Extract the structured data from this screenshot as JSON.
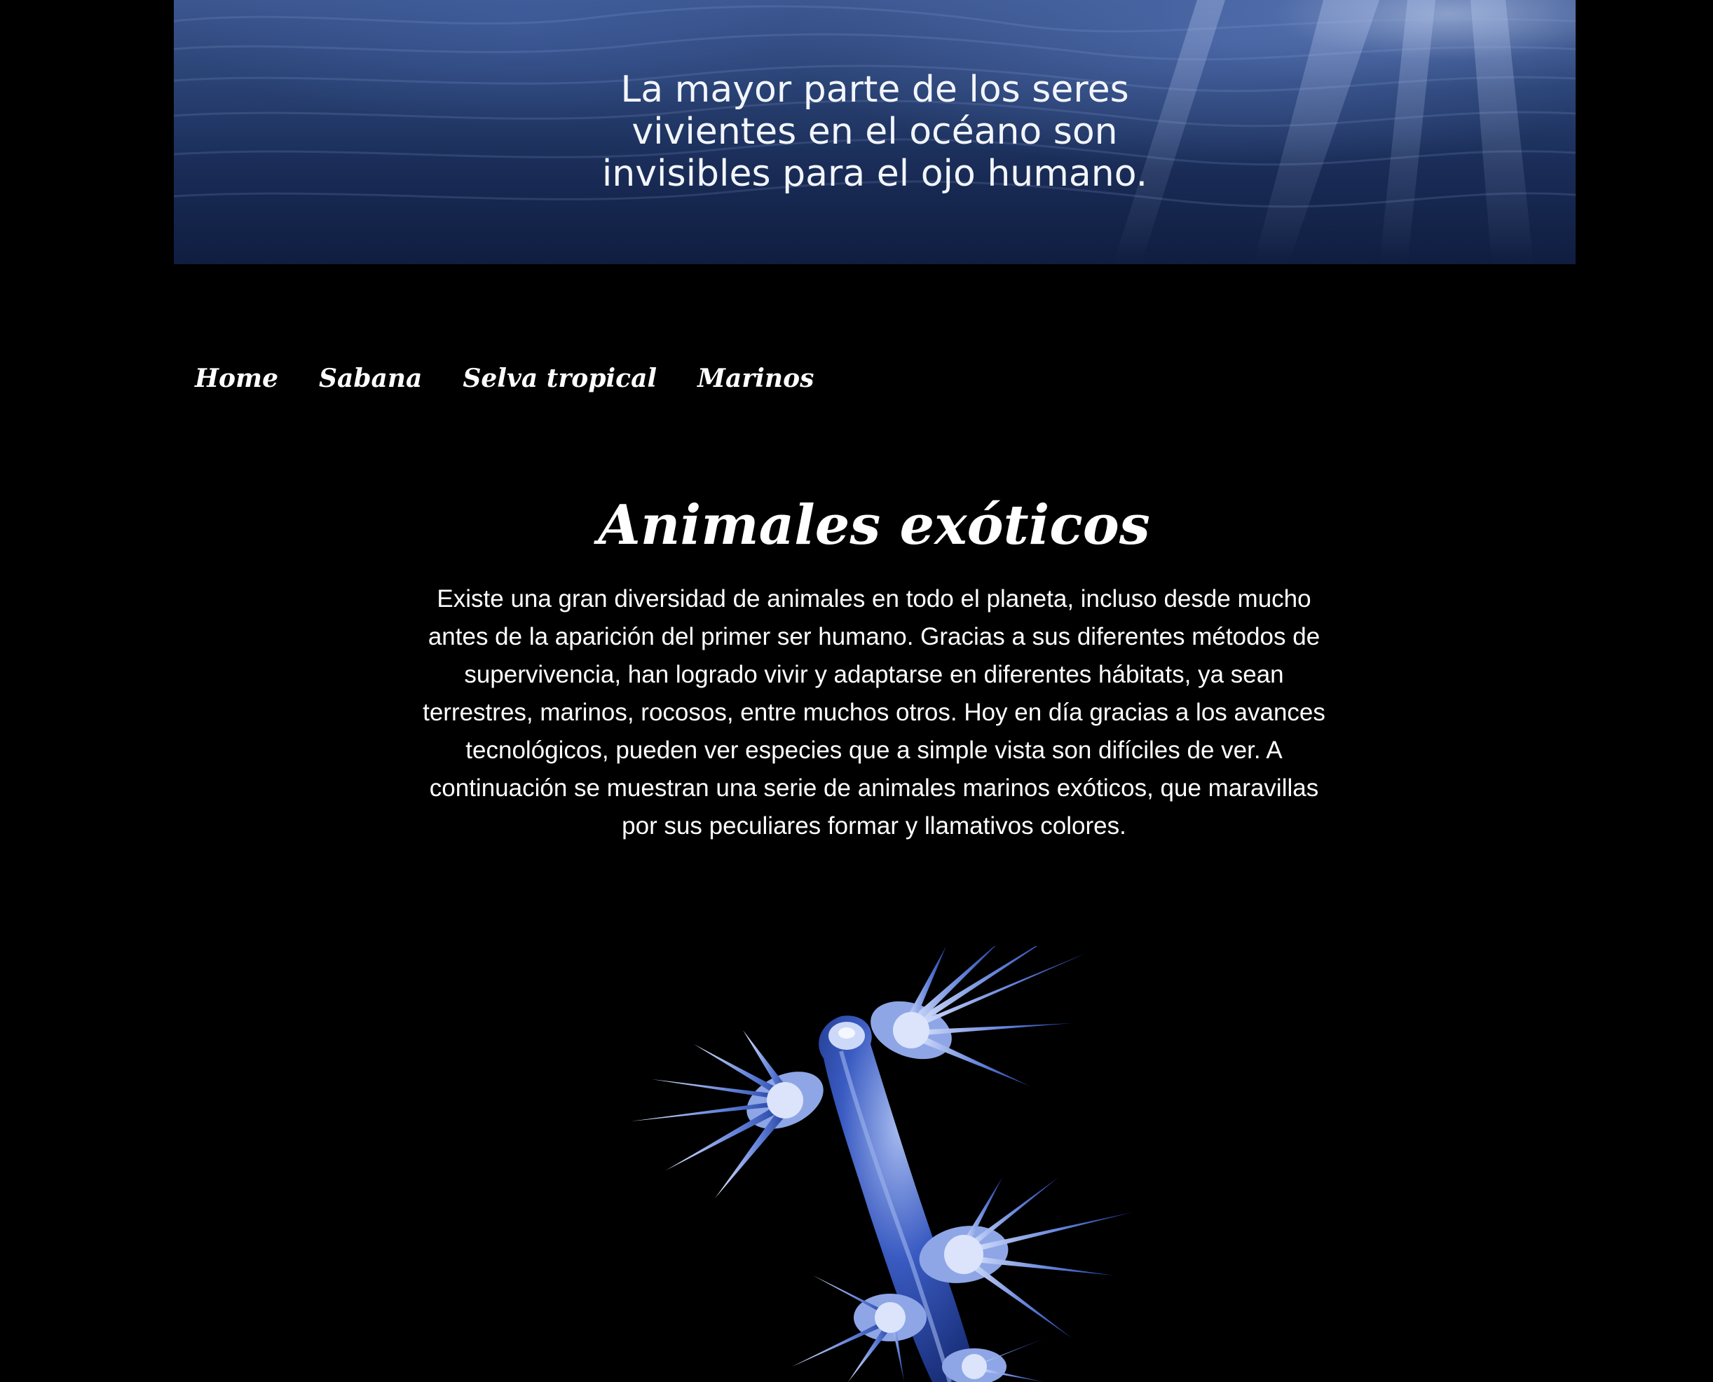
{
  "banner": {
    "quote_lines": [
      "La mayor parte de los seres",
      "vivientes en el océano son",
      "invisibles para el ojo humano."
    ]
  },
  "nav": {
    "items": [
      {
        "label": "Home"
      },
      {
        "label": "Sabana"
      },
      {
        "label": "Selva tropical"
      },
      {
        "label": "Marinos"
      }
    ]
  },
  "main": {
    "title": "Animales exóticos",
    "intro": "Existe una gran diversidad de animales en todo el planeta, incluso desde mucho antes de la aparición del primer ser humano. Gracias a sus diferentes métodos de supervivencia, han logrado vivir y adaptarse en diferentes hábitats, ya sean terrestres, marinos, rocosos, entre muchos otros. Hoy en día gracias a los avances tecnológicos, pueden ver especies que a simple vista son difíciles de ver. A continuación se muestran una serie de animales marinos exóticos, que maravillas por sus peculiares formar y llamativos colores."
  },
  "colors": {
    "page_background": "#000000",
    "banner_deep": "#0f1d3f",
    "banner_light": "#3c5790",
    "text": "#ffffff",
    "creature_blue": "#2f4fb0",
    "creature_pale": "#c9d6f5"
  }
}
